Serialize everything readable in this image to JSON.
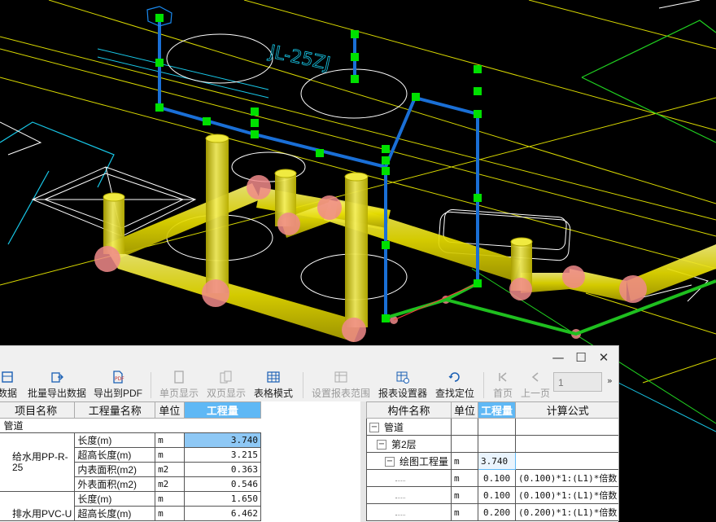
{
  "window": {
    "title_controls": {
      "minimize": "—",
      "maximize": "☐",
      "close": "✕"
    },
    "more_glyph": "»"
  },
  "toolbar": {
    "items": [
      {
        "label": "数据",
        "icon": "data-icon",
        "enabled": true
      },
      {
        "label": "批量导出数据",
        "icon": "batch-export-icon",
        "enabled": true
      },
      {
        "label": "导出到PDF",
        "icon": "pdf-export-icon",
        "enabled": true
      },
      {
        "label": "单页显示",
        "icon": "single-page-icon",
        "enabled": false
      },
      {
        "label": "双页显示",
        "icon": "double-page-icon",
        "enabled": false
      },
      {
        "label": "表格模式",
        "icon": "table-mode-icon",
        "enabled": true
      },
      {
        "label": "设置报表范围",
        "icon": "report-range-icon",
        "enabled": false
      },
      {
        "label": "报表设置器",
        "icon": "report-settings-icon",
        "enabled": true
      },
      {
        "label": "查找定位",
        "icon": "find-locate-icon",
        "enabled": true
      },
      {
        "label": "首页",
        "icon": "first-page-icon",
        "enabled": false
      },
      {
        "label": "上一页",
        "icon": "prev-page-icon",
        "enabled": false
      }
    ],
    "page_input": "1"
  },
  "left_table": {
    "headers": [
      "项目名称",
      "工程量名称",
      "单位",
      "工程量"
    ],
    "group": "管道",
    "items": [
      {
        "name": "给水用PP-R-25",
        "rows": [
          {
            "quantity_name": "长度(m)",
            "unit": "m",
            "value": "3.740"
          },
          {
            "quantity_name": "超高长度(m)",
            "unit": "m",
            "value": "3.215"
          },
          {
            "quantity_name": "内表面积(m2)",
            "unit": "m2",
            "value": "0.363"
          },
          {
            "quantity_name": "外表面积(m2)",
            "unit": "m2",
            "value": "0.546"
          }
        ]
      },
      {
        "name": "排水用PVC-U",
        "rows": [
          {
            "quantity_name": "长度(m)",
            "unit": "m",
            "value": "1.650"
          },
          {
            "quantity_name": "超高长度(m)",
            "unit": "m",
            "value": "6.462"
          }
        ]
      }
    ]
  },
  "right_table": {
    "headers": [
      "构件名称",
      "单位",
      "工程量",
      "计算公式"
    ],
    "tree": [
      {
        "label": "管道",
        "toggle": "−"
      },
      {
        "label": "第2层",
        "toggle": "−"
      },
      {
        "label": "绘图工程量",
        "toggle": "−",
        "unit": "m",
        "value": "3.740"
      }
    ],
    "rows": [
      {
        "unit": "m",
        "value": "0.100",
        "formula": "(0.100)*1:(L1)*倍数"
      },
      {
        "unit": "m",
        "value": "0.100",
        "formula": "(0.100)*1:(L1)*倍数"
      },
      {
        "unit": "m",
        "value": "0.200",
        "formula": "(0.200)*1:(L1)*倍数"
      }
    ]
  },
  "colors": {
    "pipe_yellow": "#f2ea00",
    "pipe_pink": "#f08a8a",
    "selected_pipe_blue": "#1a6fd6",
    "grip_green": "#00e000",
    "cad_white": "#ffffff",
    "cad_cyan": "#18c8e8",
    "cad_green": "#20d020",
    "highlight_header": "#5fb8f5"
  }
}
